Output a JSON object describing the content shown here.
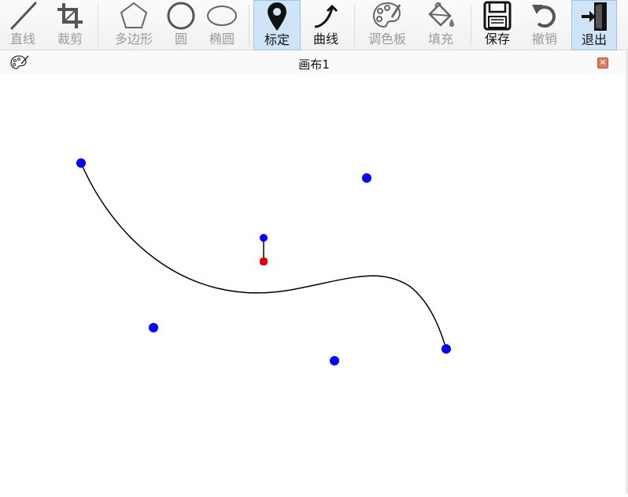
{
  "toolbar": {
    "tools": [
      {
        "id": "line",
        "label": "直线",
        "icon": "line-icon",
        "state": "disabled"
      },
      {
        "id": "crop",
        "label": "裁剪",
        "icon": "crop-icon",
        "state": "disabled"
      },
      {
        "id": "polygon",
        "label": "多边形",
        "icon": "pentagon-icon",
        "state": "disabled"
      },
      {
        "id": "circle",
        "label": "圆",
        "icon": "circle-icon",
        "state": "disabled"
      },
      {
        "id": "ellipse",
        "label": "椭圆",
        "icon": "ellipse-icon",
        "state": "disabled"
      },
      {
        "id": "mark",
        "label": "标定",
        "icon": "map-pin-icon",
        "state": "active"
      },
      {
        "id": "curve",
        "label": "曲线",
        "icon": "curve-arrow-icon",
        "state": "enabled"
      },
      {
        "id": "palette",
        "label": "调色板",
        "icon": "palette-icon",
        "state": "disabled"
      },
      {
        "id": "fill",
        "label": "填充",
        "icon": "paint-bucket-icon",
        "state": "disabled"
      },
      {
        "id": "save",
        "label": "保存",
        "icon": "floppy-disk-icon",
        "state": "enabled"
      },
      {
        "id": "undo",
        "label": "撤销",
        "icon": "undo-icon",
        "state": "disabled"
      },
      {
        "id": "exit",
        "label": "退出",
        "icon": "exit-door-icon",
        "state": "enabled"
      }
    ]
  },
  "canvas_window": {
    "title": "画布1",
    "close_glyph": "×"
  },
  "colors": {
    "control_point": "#0000ff",
    "selected_point": "#e00000",
    "curve": "#000000",
    "active_tool_bg": "#cfe4f7"
  }
}
